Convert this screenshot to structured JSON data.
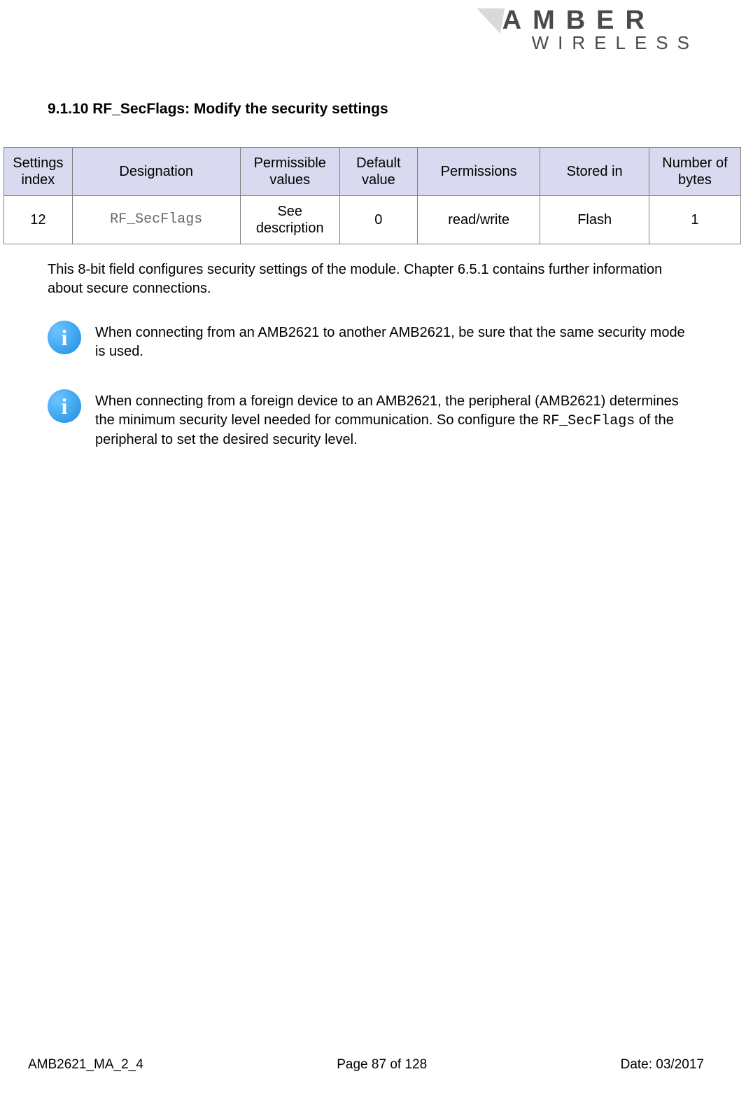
{
  "logo": {
    "line1": "AMBER",
    "line2": "WIRELESS"
  },
  "heading": "9.1.10 RF_SecFlags: Modify the security settings",
  "table": {
    "headers": [
      "Settings index",
      "Designation",
      "Permissible values",
      "Default value",
      "Permissions",
      "Stored in",
      "Number of bytes"
    ],
    "row": {
      "index": "12",
      "designation": "RF_SecFlags",
      "permissible": "See description",
      "default": "0",
      "permissions": "read/write",
      "stored": "Flash",
      "bytes": "1"
    }
  },
  "body": "This 8-bit field configures security settings of the module. Chapter 6.5.1 contains further information about secure connections.",
  "notes": {
    "n1": "When connecting from an AMB2621 to another AMB2621, be sure that the same security mode is used.",
    "n2a": "When connecting from a foreign device to an AMB2621, the peripheral (AMB2621) determines the minimum security level needed for communication. So configure the ",
    "n2code": "RF_SecFlags",
    "n2b": " of the peripheral to set the desired security level."
  },
  "footer": {
    "doc": "AMB2621_MA_2_4",
    "page": "Page 87 of 128",
    "date": "Date: 03/2017"
  }
}
